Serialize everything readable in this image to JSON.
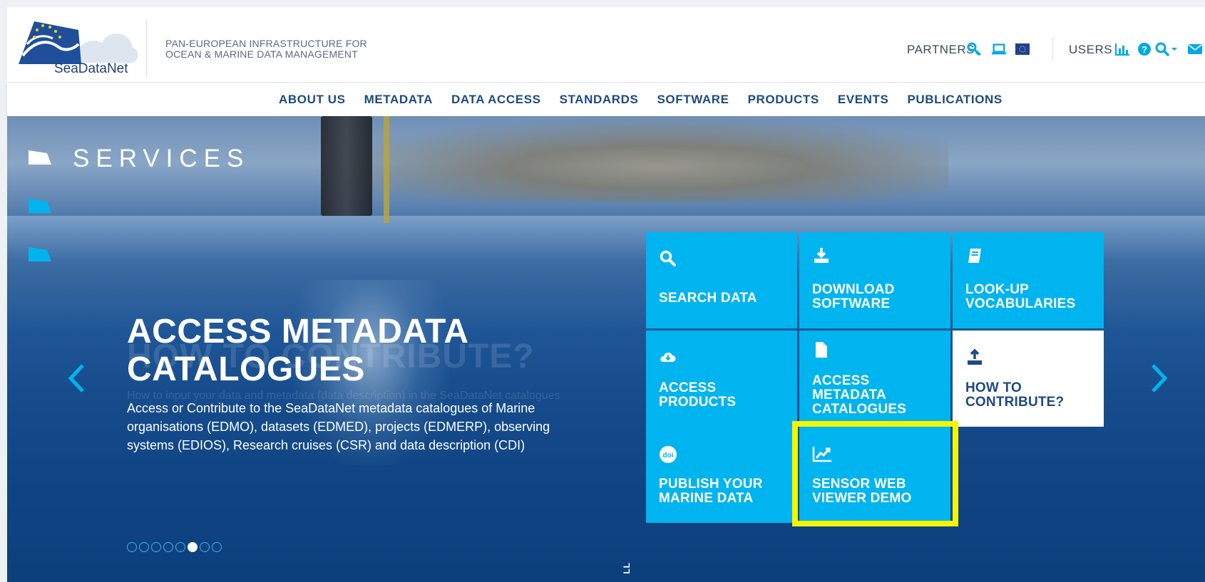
{
  "header": {
    "logo_text": "SeaDataNet",
    "tagline_line1": "PAN-EUROPEAN INFRASTRUCTURE FOR",
    "tagline_line2": "OCEAN & MARINE DATA MANAGEMENT",
    "partners_label": "PARTNERS",
    "users_label": "USERS",
    "partner_icons": [
      "key-icon",
      "laptop-icon",
      "eu-flag-icon"
    ],
    "user_icons": [
      "bar-chart-icon",
      "help-icon",
      "search-icon",
      "chevron-down-icon",
      "mail-icon"
    ]
  },
  "nav": {
    "items": [
      "ABOUT US",
      "METADATA",
      "DATA ACCESS",
      "STANDARDS",
      "SOFTWARE",
      "PRODUCTS",
      "EVENTS",
      "PUBLICATIONS"
    ]
  },
  "hero": {
    "section_label": "SERVICES",
    "ghost_title": "HOW TO CONTRIBUTE?",
    "ghost_desc": "How to input your data and metadata (data description) in the SeaDataNet catalogues",
    "title_line1": "ACCESS METADATA",
    "title_line2": "CATALOGUES",
    "description": "Access or Contribute to the SeaDataNet metadata catalogues of Marine organisations (EDMO), datasets (EDMED), projects (EDMERP), observing systems (EDIOS), Research cruises (CSR) and data description (CDI)",
    "scroll_hint": "LL",
    "carousel_total": 8,
    "carousel_active_index": 5
  },
  "tiles": [
    {
      "line1": "SEARCH DATA",
      "line2": "",
      "icon": "search-icon",
      "style": "blue"
    },
    {
      "line1": "DOWNLOAD",
      "line2": "SOFTWARE",
      "icon": "download-icon",
      "style": "blue"
    },
    {
      "line1": "LOOK-UP",
      "line2": "VOCABULARIES",
      "icon": "book-icon",
      "style": "blue"
    },
    {
      "line1": "ACCESS",
      "line2": "PRODUCTS",
      "icon": "cloud-download-icon",
      "style": "blue"
    },
    {
      "line1": "ACCESS",
      "line2": "METADATA",
      "line3": "CATALOGUES",
      "icon": "file-icon",
      "style": "blue"
    },
    {
      "line1": "HOW TO",
      "line2": "CONTRIBUTE?",
      "icon": "upload-icon",
      "style": "white"
    },
    {
      "line1": "PUBLISH YOUR",
      "line2": "MARINE DATA",
      "icon": "doi-icon",
      "style": "blue"
    },
    {
      "line1": "SENSOR WEB",
      "line2": "VIEWER DEMO",
      "icon": "line-chart-icon",
      "style": "blue",
      "highlighted": true
    }
  ],
  "colors": {
    "tile_blue": "#00b4ef",
    "nav_text": "#1d4a80",
    "highlight": "#f6f500",
    "accent_icon": "#00a9e6"
  }
}
